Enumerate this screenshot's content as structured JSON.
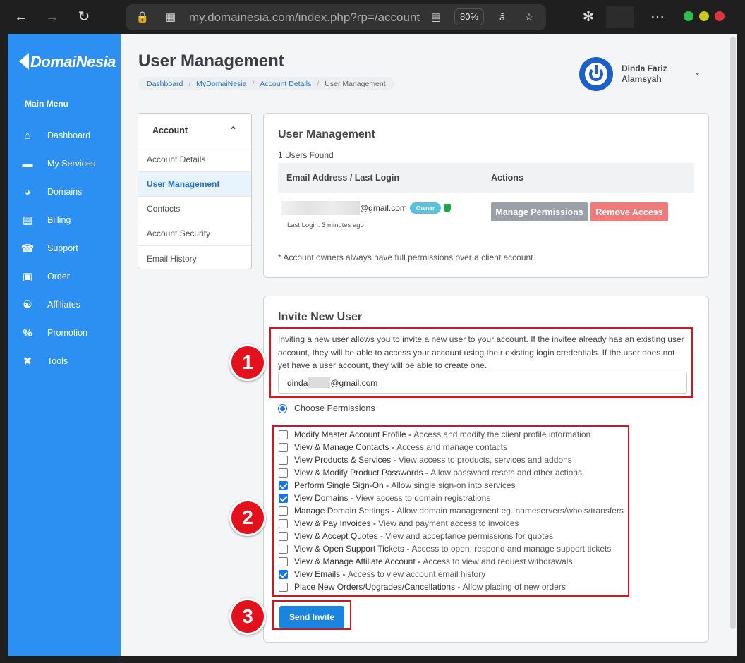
{
  "browser": {
    "url": "my.domainesia.com/index.php?rp=/account/users",
    "zoom": "80%"
  },
  "sidebar": {
    "logo": "DomaiNesia",
    "menu_title": "Main Menu",
    "items": [
      {
        "label": "Dashboard",
        "icon": "home-icon"
      },
      {
        "label": "My Services",
        "icon": "server-icon"
      },
      {
        "label": "Domains",
        "icon": "globe-icon"
      },
      {
        "label": "Billing",
        "icon": "receipt-icon"
      },
      {
        "label": "Support",
        "icon": "headset-icon"
      },
      {
        "label": "Order",
        "icon": "cart-icon"
      },
      {
        "label": "Affiliates",
        "icon": "handshake-icon"
      },
      {
        "label": "Promotion",
        "icon": "percent-icon"
      },
      {
        "label": "Tools",
        "icon": "tools-icon"
      }
    ]
  },
  "header": {
    "title": "User Management",
    "breadcrumb": [
      "Dashboard",
      "MyDomaiNesia",
      "Account Details",
      "User Management"
    ],
    "user_name": "Dinda Fariz Alamsyah"
  },
  "account_menu": {
    "heading": "Account",
    "items": [
      "Account Details",
      "User Management",
      "Contacts",
      "Account Security",
      "Email History"
    ],
    "active": "User Management"
  },
  "user_management": {
    "title": "User Management",
    "users_found": "1 Users Found",
    "columns": [
      "Email Address / Last Login",
      "Actions"
    ],
    "row": {
      "email_suffix": "@gmail.com",
      "badge": "Owner",
      "last_login": "Last Login: 3 minutes ago",
      "manage_label": "Manage Permissions",
      "remove_label": "Remove Access"
    },
    "note": "* Account owners always have full permissions over a client account."
  },
  "invite": {
    "title": "Invite New User",
    "description": "Inviting a new user allows you to invite a new user to your account. If the invitee already has an existing user account, they will be able to access your account using their existing login credentials. If the user does not yet have a user account, they will be able to create one.",
    "email_prefix": "dinda",
    "email_suffix": "@gmail.com",
    "permissions_option": "Choose Permissions",
    "permissions": [
      {
        "name": "Modify Master Account Profile",
        "desc": "Access and modify the client profile information",
        "checked": false
      },
      {
        "name": "View & Manage Contacts",
        "desc": "Access and manage contacts",
        "checked": false
      },
      {
        "name": "View Products & Services",
        "desc": "View access to products, services and addons",
        "checked": false
      },
      {
        "name": "View & Modify Product Passwords",
        "desc": "Allow password resets and other actions",
        "checked": false
      },
      {
        "name": "Perform Single Sign-On",
        "desc": "Allow single sign-on into services",
        "checked": true
      },
      {
        "name": "View Domains",
        "desc": "View access to domain registrations",
        "checked": true
      },
      {
        "name": "Manage Domain Settings",
        "desc": "Allow domain management eg. nameservers/whois/transfers",
        "checked": false
      },
      {
        "name": "View & Pay Invoices",
        "desc": "View and payment access to invoices",
        "checked": false
      },
      {
        "name": "View & Accept Quotes",
        "desc": "View and acceptance permissions for quotes",
        "checked": false
      },
      {
        "name": "View & Open Support Tickets",
        "desc": "Access to open, respond and manage support tickets",
        "checked": false
      },
      {
        "name": "View & Manage Affiliate Account",
        "desc": "Access to view and request withdrawals",
        "checked": false
      },
      {
        "name": "View Emails",
        "desc": "Access to view account email history",
        "checked": true
      },
      {
        "name": "Place New Orders/Upgrades/Cancellations",
        "desc": "Allow placing of new orders",
        "checked": false
      }
    ],
    "send_label": "Send Invite"
  },
  "steps": [
    "1",
    "2",
    "3"
  ],
  "colors": {
    "sidebar": "#2c8ff2",
    "highlight": "#e0101b",
    "primary_button": "#1a85e0",
    "remove_button": "#f07a7a",
    "owner_badge": "#5bc0de"
  }
}
